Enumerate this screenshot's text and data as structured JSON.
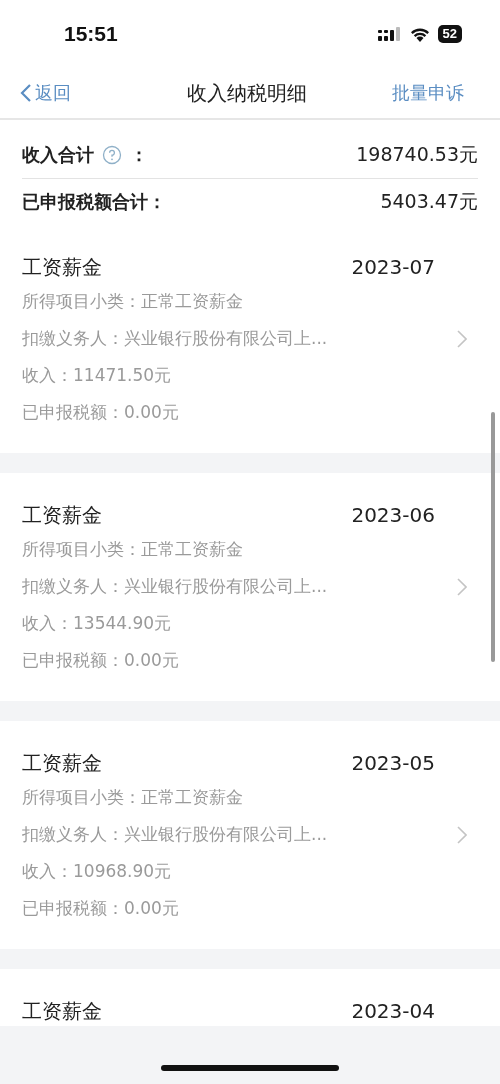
{
  "status_bar": {
    "time": "15:51",
    "battery": "52"
  },
  "nav": {
    "back": "返回",
    "title": "收入纳税明细",
    "action": "批量申诉"
  },
  "summary": [
    {
      "label": "收入合计",
      "help": true,
      "colon": "：",
      "value": "198740.53元"
    },
    {
      "label": "已申报税额合计：",
      "help": false,
      "value": "5403.47元"
    }
  ],
  "records": [
    {
      "title": "工资薪金",
      "date": "2023-07",
      "lines": [
        "所得项目小类：正常工资薪金",
        "扣缴义务人：兴业银行股份有限公司上...",
        "收入：11471.50元",
        "已申报税额：0.00元"
      ]
    },
    {
      "title": "工资薪金",
      "date": "2023-06",
      "lines": [
        "所得项目小类：正常工资薪金",
        "扣缴义务人：兴业银行股份有限公司上...",
        "收入：13544.90元",
        "已申报税额：0.00元"
      ]
    },
    {
      "title": "工资薪金",
      "date": "2023-05",
      "lines": [
        "所得项目小类：正常工资薪金",
        "扣缴义务人：兴业银行股份有限公司上...",
        "收入：10968.90元",
        "已申报税额：0.00元"
      ]
    },
    {
      "title": "工资薪金",
      "date": "2023-04"
    }
  ]
}
